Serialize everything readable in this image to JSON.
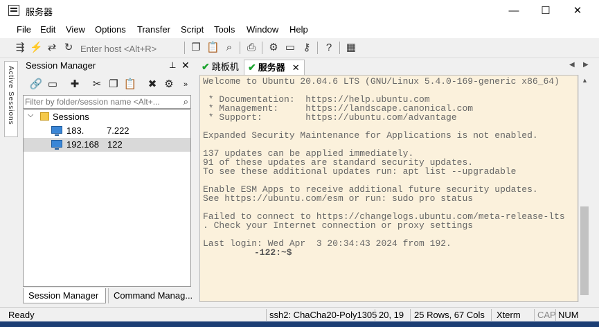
{
  "window": {
    "title": "服务器",
    "minimize": "—",
    "maximize": "☐",
    "close": "✕"
  },
  "menu": [
    "File",
    "Edit",
    "View",
    "Options",
    "Transfer",
    "Script",
    "Tools",
    "Window",
    "Help"
  ],
  "toolbar": {
    "host_placeholder": "Enter host <Alt+R>",
    "icons": [
      "connect-icon",
      "quick-connect-icon",
      "connect-tab-icon",
      "reconnect-icon",
      "copy-icon",
      "paste-icon",
      "find-icon",
      "print-icon",
      "settings-icon",
      "keymap-icon",
      "keygen-icon",
      "help-icon",
      "sftp-icon"
    ]
  },
  "side_tab": {
    "label": "Active Sessions"
  },
  "session_manager": {
    "title": "Session Manager",
    "pin": "⊥",
    "close": "✕",
    "filter_placeholder": "Filter by folder/session name <Alt+...",
    "tree": {
      "folder": "Sessions",
      "sessions": [
        {
          "label": "183.",
          "suffix": "7.222",
          "selected": false
        },
        {
          "label": "192.168",
          "suffix": "122",
          "selected": true
        }
      ]
    },
    "bottom_tabs": [
      "Session Manager",
      "Command Manag..."
    ]
  },
  "tabs": [
    {
      "label": "跳板机",
      "active": false
    },
    {
      "label": "服务器",
      "active": true,
      "close": "✕"
    }
  ],
  "terminal": {
    "lines": [
      "Welcome to Ubuntu 20.04.6 LTS (GNU/Linux 5.4.0-169-generic x86_64)",
      "",
      " * Documentation:  https://help.ubuntu.com",
      " * Management:     https://landscape.canonical.com",
      " * Support:        https://ubuntu.com/advantage",
      "",
      "Expanded Security Maintenance for Applications is not enabled.",
      "",
      "137 updates can be applied immediately.",
      "91 of these updates are standard security updates.",
      "To see these additional updates run: apt list --upgradable",
      "",
      "Enable ESM Apps to receive additional future security updates.",
      "See https://ubuntu.com/esm or run: sudo pro status",
      "",
      "Failed to connect to https://changelogs.ubuntu.com/meta-release-lts",
      ". Check your Internet connection or proxy settings",
      "",
      "Last login: Wed Apr  3 20:34:43 2024 from 192."
    ],
    "prompt": "-122:~$"
  },
  "status": {
    "ready": "Ready",
    "cipher": "ssh2: ChaCha20-Poly1305",
    "cursor": "20, 19",
    "size": "25 Rows, 67 Cols",
    "terminal_type": "Xterm",
    "cap": "CAP",
    "num": "NUM"
  }
}
